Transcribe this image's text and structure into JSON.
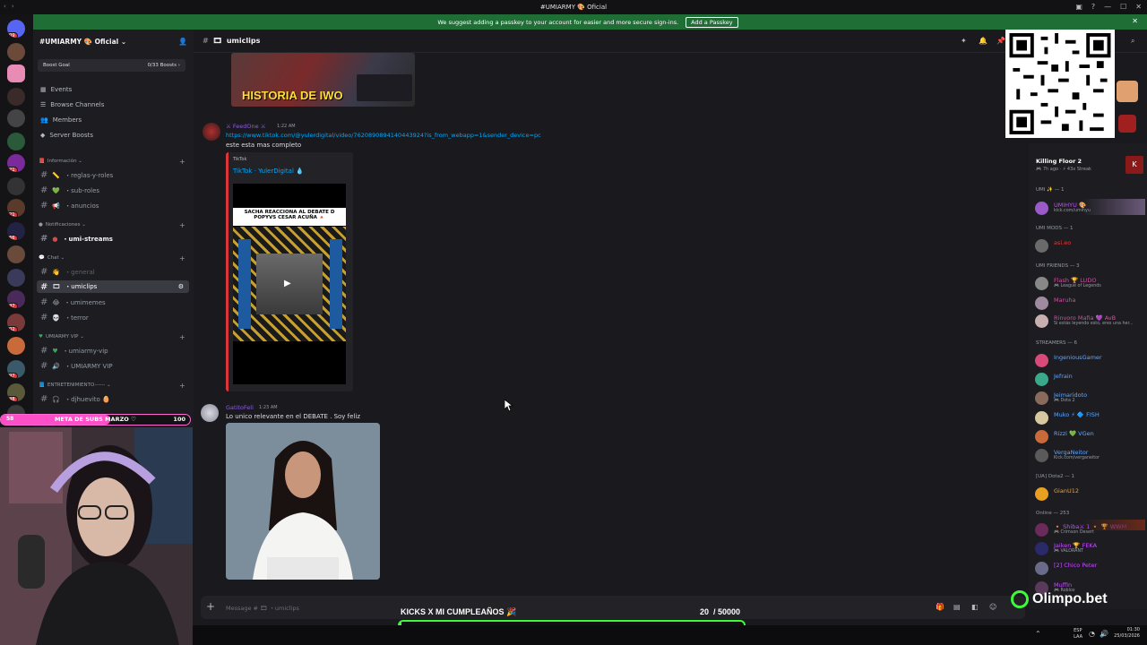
{
  "window": {
    "title": "#UMIARMY 🎨 Oficial"
  },
  "banner": {
    "text": "We suggest adding a passkey to your account for easier and more secure sign-ins.",
    "button": "Add a Passkey"
  },
  "server_rail": {
    "badges": [
      "409",
      "121",
      "121",
      "166",
      "147",
      "802",
      "797",
      "148",
      "58"
    ]
  },
  "server": {
    "name": "#UMIARMY 🎨 Oficial ⌄"
  },
  "boost": {
    "label": "Boost Goal",
    "value": "0/33 Boosts ›"
  },
  "nav": {
    "events": "Events",
    "browse": "Browse Channels",
    "members": "Members",
    "boosts": "Server Boosts"
  },
  "categories": {
    "info": "Información ⌄",
    "notif": "Notificaciones ⌄",
    "chat": "Chat ⌄",
    "vip": "UMIARMY VIP ⌄",
    "ent": "ENTRETENIMIENTO------ ⌄"
  },
  "channels": {
    "reglas": "・reglas-y-roles",
    "subroles": "・sub-roles",
    "anuncios": "・anuncios",
    "streams": "・umi-streams",
    "general": "・general",
    "umiclips": "・umiclips",
    "umimemes": "・umimemes",
    "terror": "・terror",
    "umiarmyvip": "・umiarmy-vip",
    "vipvoice": "・UMIARMY VIP",
    "djhuevito": "・djhuevito 🥚"
  },
  "header": {
    "channel": "umiclips"
  },
  "messages": {
    "m1": {
      "user": "⚔ FeedOne ⚔",
      "time": "1:22 AM",
      "link": "https://www.tiktok.com/@yulerdigital/video/7620890894140443924?is_from_webapp=1&sender_device=pc",
      "text": "este esta mas completo"
    },
    "embed": {
      "provider": "TikTok",
      "title": "TikTok · YulerDigital 💧",
      "video_caption": "SACHA REACCIONA AL DEBATE D POPYVS CESAR ACUÑA 🔺",
      "top_thumb": "HISTORIA DE IWO"
    },
    "m2": {
      "user": "GatitoFeli",
      "time": "1:23 AM",
      "text": "Lo unico relevante en el DEBATE . Soy feliz"
    }
  },
  "composer": {
    "placeholder": "Message # 🎞 ・umiclips"
  },
  "members": {
    "activity": {
      "game": "Killing Floor 2",
      "sub": "🎮 7h ago · ⚡ 43x Streak"
    },
    "cats": {
      "umi": "UMI ✨ — 1",
      "mods": "UMI MODS — 1",
      "friends": "UMI FRIENDS — 3",
      "streamers": "STREAMERS — 6",
      "dota": "[UA] Dota2 — 1",
      "online": "Online — 253"
    },
    "list": [
      {
        "name": "UMIHYU 🎨",
        "sub": "kick.com/umihyu",
        "color": "#c44dff"
      },
      {
        "name": "asi.eo",
        "sub": "",
        "color": "#e03a3a"
      },
      {
        "name": "Flash 🏆 LUDO",
        "sub": "🎮 League of Legends",
        "color": "#d14fa0"
      },
      {
        "name": "Maruha",
        "sub": "",
        "color": "#d14fa0"
      },
      {
        "name": "Rinvoro Mafia 💜 AvB",
        "sub": "Si estás leyendo esto, eres una her...",
        "color": "#d14fa0"
      },
      {
        "name": "IngeniousGamer",
        "sub": "",
        "color": "#5fa6ff"
      },
      {
        "name": "Jefrain",
        "sub": "",
        "color": "#5fa6ff"
      },
      {
        "name": "Jeimaridoto",
        "sub": "🎮 Dota 2",
        "color": "#5fa6ff"
      },
      {
        "name": "Muko ⚡ 🔷 FISH",
        "sub": "",
        "color": "#5fa6ff"
      },
      {
        "name": "Rizzi 💚 VGen",
        "sub": "",
        "color": "#5fa6ff"
      },
      {
        "name": "VergaNeitor",
        "sub": "Kick.com/verganeitor",
        "color": "#5fa6ff"
      },
      {
        "name": "GianU12",
        "sub": "",
        "color": "#f0a030"
      },
      {
        "name": "🔸 Shiba⚔ 1 🔸 🏆 WWM",
        "sub": "🎮 Crimson Desert",
        "color": "#c44dff"
      },
      {
        "name": "Jaiken 🏆 FEKA",
        "sub": "🎮 VALORANT",
        "color": "#c44dff"
      },
      {
        "name": "[2] Chico Peter",
        "sub": "",
        "color": "#c44dff"
      },
      {
        "name": "Muffin",
        "sub": "🎮 Roblox",
        "color": "#c44dff"
      }
    ]
  },
  "overlay": {
    "subgoal": {
      "count": "58",
      "title": "META DE SUBS MARZO ♡",
      "goal": "100",
      "progress": 0.58
    },
    "kicks": {
      "title": "KICKS X MI CUMPLEAÑOS 🎉",
      "current": "20",
      "target": "/ 50000",
      "progress": 0.0004
    },
    "sponsor": "Olimpo.bet"
  },
  "taskbar": {
    "lang1": "ESP",
    "lang2": "LAA",
    "time": "01:30",
    "date": "25/03/2026"
  },
  "colors": {
    "accent": "#5865f2",
    "banner": "#1f6e36",
    "kick_green": "#3cfa3c",
    "sub_pink": "#ff4fc8"
  }
}
